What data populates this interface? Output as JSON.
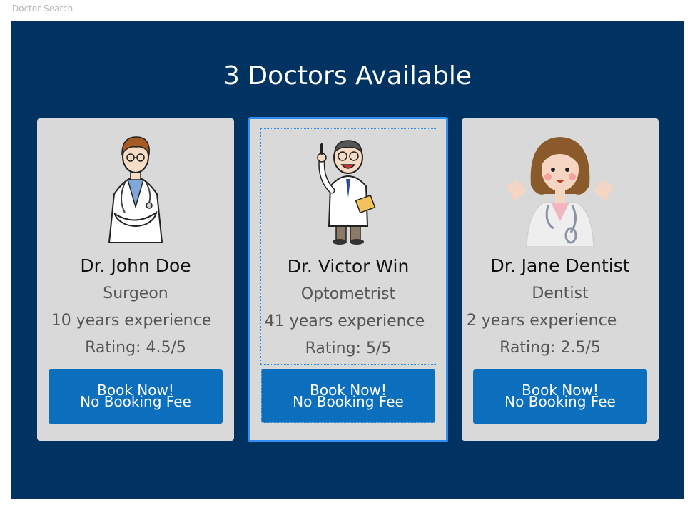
{
  "window": {
    "title": "Doctor Search"
  },
  "header": {
    "title": "3 Doctors Available"
  },
  "doctors": [
    {
      "name": "Dr. John Doe",
      "specialty": "Surgeon",
      "experience": "10 years experience",
      "rating": "Rating: 4.5/5",
      "book_line1": "Book Now!",
      "book_line2": "No Booking Fee",
      "icon": "male-doctor-arms-crossed-icon"
    },
    {
      "name": "Dr. Victor Win",
      "specialty": "Optometrist",
      "experience": "41 years experience",
      "rating": "Rating: 5/5",
      "book_line1": "Book Now!",
      "book_line2": "No Booking Fee",
      "icon": "older-male-doctor-pointing-icon"
    },
    {
      "name": "Dr. Jane Dentist",
      "specialty": "Dentist",
      "experience": "2 years experience",
      "rating": "Rating: 2.5/5",
      "book_line1": "Book Now!",
      "book_line2": "No Booking Fee",
      "icon": "female-doctor-waving-icon"
    }
  ],
  "colors": {
    "panel_bg": "#003262",
    "card_bg": "#d9d9d9",
    "button_bg": "#0b6fbe",
    "focus_border": "#2f8ff0"
  }
}
